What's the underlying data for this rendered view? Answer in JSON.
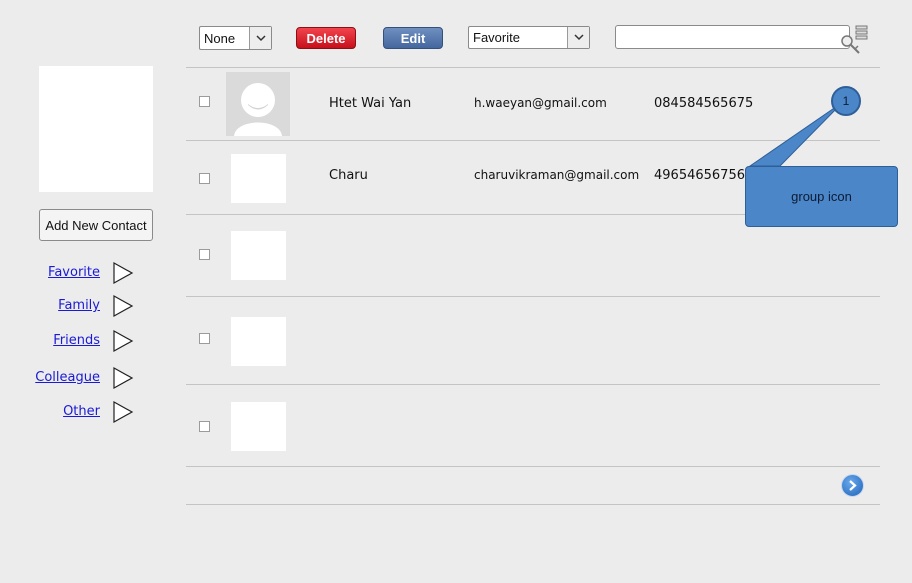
{
  "sidebar": {
    "add_contact_label": "Add New Contact",
    "groups": [
      {
        "label": "Favorite"
      },
      {
        "label": "Family"
      },
      {
        "label": "Friends"
      },
      {
        "label": "Colleague"
      },
      {
        "label": "Other"
      }
    ]
  },
  "toolbar": {
    "select_filter_value": "None",
    "delete_label": "Delete",
    "edit_label": "Edit",
    "group_select_value": "Favorite",
    "search_value": ""
  },
  "contacts": [
    {
      "name": "Htet Wai Yan",
      "email": "h.waeyan@gmail.com",
      "phone": "084584565675"
    },
    {
      "name": "Charu",
      "email": "charuvikraman@gmail.com",
      "phone": "49654656756"
    },
    {
      "name": "",
      "email": "",
      "phone": ""
    },
    {
      "name": "",
      "email": "",
      "phone": ""
    },
    {
      "name": "",
      "email": "",
      "phone": ""
    }
  ],
  "annotation": {
    "marker_number": "1",
    "callout_text": "group icon"
  },
  "colors": {
    "delete": "#d7141d",
    "edit": "#5577ad",
    "annotation": "#4a86c8",
    "link": "#1a1ad6"
  },
  "icons": {
    "key_icon": "keys-icon",
    "next_icon": "chevron-right-icon",
    "group_arrow_icon": "play-triangle-icon"
  }
}
